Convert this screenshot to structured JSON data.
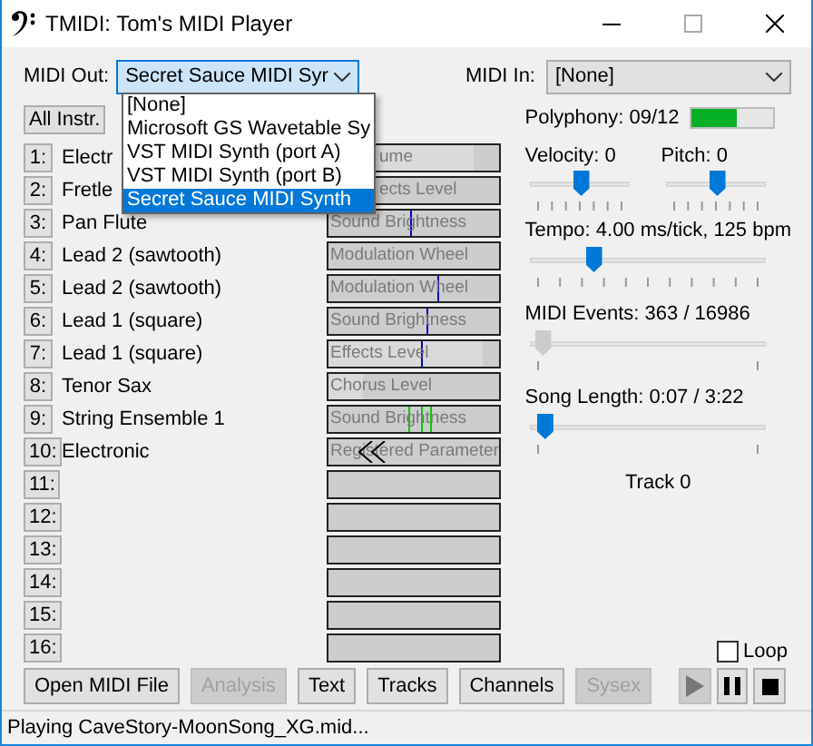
{
  "window": {
    "title": "TMIDI: Tom's MIDI Player"
  },
  "midi_out": {
    "label": "MIDI Out:",
    "value": "Secret Sauce MIDI Syr",
    "expanded": true,
    "options": [
      {
        "label": "[None]",
        "selected": false
      },
      {
        "label": "Microsoft GS Wavetable Sy",
        "selected": false
      },
      {
        "label": "VST MIDI Synth (port A)",
        "selected": false
      },
      {
        "label": "VST MIDI Synth (port B)",
        "selected": false
      },
      {
        "label": "Secret Sauce MIDI Synth",
        "selected": true
      }
    ]
  },
  "midi_in": {
    "label": "MIDI In:",
    "value": "[None]"
  },
  "all_instruments_button": "All Instr.",
  "channels": [
    {
      "number": "1:",
      "name": "Electr",
      "covered": true,
      "bar": {
        "label": "ume",
        "level": 0.85
      }
    },
    {
      "number": "2:",
      "name": "Fretle",
      "covered": true,
      "bar": {
        "label": "ects Level"
      }
    },
    {
      "number": "3:",
      "name": "Pan Flute",
      "bar": {
        "label": "Sound Brightness",
        "markers": [
          {
            "level": 0.48,
            "color": "#0000cc"
          }
        ]
      }
    },
    {
      "number": "4:",
      "name": "Lead 2 (sawtooth)",
      "bar": {
        "label": "Modulation Wheel"
      }
    },
    {
      "number": "5:",
      "name": "Lead 2 (sawtooth)",
      "bar": {
        "label": "Modulation Wheel",
        "markers": [
          {
            "level": 0.64,
            "color": "#0000cc"
          }
        ]
      }
    },
    {
      "number": "6:",
      "name": "Lead 1 (square)",
      "bar": {
        "label": "Sound Brightness",
        "markers": [
          {
            "level": 0.57,
            "color": "#0000cc"
          }
        ]
      }
    },
    {
      "number": "7:",
      "name": "Lead 1 (square)",
      "bar": {
        "label": "Effects Level",
        "level": 0.9,
        "markers": [
          {
            "level": 0.54,
            "color": "#0000cc"
          }
        ]
      }
    },
    {
      "number": "8:",
      "name": "Tenor Sax",
      "bar": {
        "label": "Chorus Level",
        "level": 0.2
      }
    },
    {
      "number": "9:",
      "name": "String Ensemble 1",
      "bar": {
        "label": "Sound Brightness",
        "markers": [
          {
            "level": 0.47,
            "color": "#00cc00"
          },
          {
            "level": 0.54,
            "color": "#00cc00"
          },
          {
            "level": 0.6,
            "color": "#00cc00"
          }
        ]
      }
    },
    {
      "number": "10:",
      "name": "Electronic",
      "bar": {
        "label": "Registered Parameter",
        "arrows": true
      }
    },
    {
      "number": "11:"
    },
    {
      "number": "12:"
    },
    {
      "number": "13:"
    },
    {
      "number": "14:"
    },
    {
      "number": "15:"
    },
    {
      "number": "16:"
    }
  ],
  "polyphony": {
    "label": "Polyphony: 09/12",
    "level": 0.55
  },
  "velocity": {
    "label": "Velocity: 0",
    "level": 0.5,
    "kind": "ticked"
  },
  "pitch": {
    "label": "Pitch: 0",
    "level": 0.5,
    "kind": "ticked"
  },
  "tempo": {
    "label": "Tempo: 4.00 ms/tick, 125 bpm",
    "level": 0.25,
    "kind": "ticked"
  },
  "midi_events": {
    "label": "MIDI Events: 363 / 16986",
    "level": 0.02,
    "kind": "ends",
    "disabled": true
  },
  "song_length": {
    "label": "Song Length: 0:07 / 3:22",
    "level": 0.03,
    "kind": "ends",
    "disabled": false
  },
  "track": "Track 0",
  "loop": {
    "label": "Loop",
    "checked": false
  },
  "buttons": [
    {
      "label": "Open MIDI File",
      "disabled": false
    },
    {
      "label": "Analysis",
      "disabled": true
    },
    {
      "label": "Text",
      "disabled": false
    },
    {
      "label": "Tracks",
      "disabled": false
    },
    {
      "label": "Channels",
      "disabled": false
    },
    {
      "label": "Sysex",
      "disabled": true
    }
  ],
  "transport": [
    {
      "kind": "play",
      "disabled": true
    },
    {
      "kind": "pause",
      "disabled": false
    },
    {
      "kind": "stop",
      "disabled": false
    }
  ],
  "status_bar": "Playing CaveStory-MoonSong_XG.mid..."
}
